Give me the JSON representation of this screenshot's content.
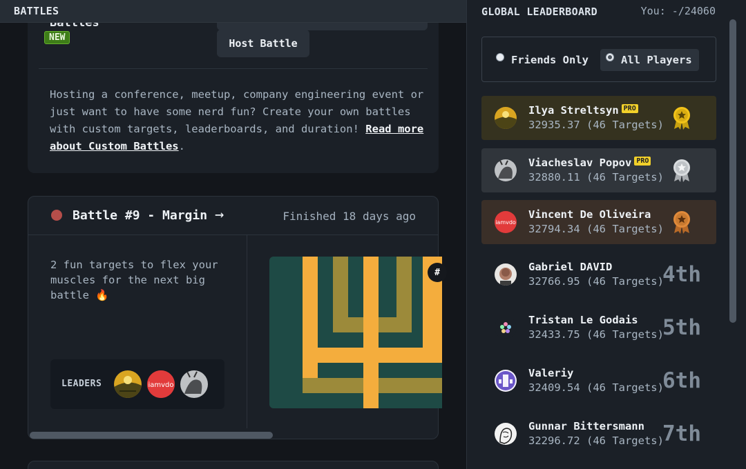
{
  "left": {
    "header_title": "BATTLES",
    "custom_battles": {
      "title": "Battles",
      "badge": "NEW",
      "host_button": "Host Battle",
      "description": "Hosting a conference, meetup, company engineering event or just want to have some nerd fun? Create your own battles with custom targets, leaderboards, and duration!",
      "link_text": "Read more about Custom Battles",
      "link_suffix": "."
    },
    "battle": {
      "title": "Battle #9 - Margin",
      "arrow": "→",
      "status": "Finished 18 days ago",
      "description": "2 fun targets to flex your muscles for the next big battle 🔥",
      "leaders_label": "LEADERS",
      "leader_avatar_text": "iamvdo",
      "target_badge": "#",
      "target_colors": {
        "background": "#1e4a45",
        "primary": "#f4ad3d",
        "secondary": "#9c8a3a"
      }
    }
  },
  "leaderboard": {
    "title": "GLOBAL LEADERBOARD",
    "you": "You: -/24060",
    "filters": [
      {
        "label": "Friends Only",
        "selected": false
      },
      {
        "label": "All Players",
        "selected": true
      }
    ],
    "players": [
      {
        "name": "Ilya Streltsyn",
        "pro": "PRO",
        "score": "32935.37 (46 Targets)",
        "rank": "",
        "medal": "gold",
        "row_color": "#35321f"
      },
      {
        "name": "Viacheslav Popov",
        "pro": "PRO",
        "score": "32880.11 (46 Targets)",
        "rank": "",
        "medal": "silver",
        "row_color": "#30353b"
      },
      {
        "name": "Vincent De Oliveira",
        "pro": "",
        "score": "32794.34 (46 Targets)",
        "rank": "",
        "medal": "bronze",
        "row_color": "#3a2f28",
        "avatar_text": "iamvdo"
      },
      {
        "name": "Gabriel DAVID",
        "pro": "",
        "score": "32766.95 (46 Targets)",
        "rank": "4th"
      },
      {
        "name": "Tristan Le Godais",
        "pro": "",
        "score": "32433.75 (46 Targets)",
        "rank": "5th"
      },
      {
        "name": "Valeriy",
        "pro": "",
        "score": "32409.54 (46 Targets)",
        "rank": "6th"
      },
      {
        "name": "Gunnar Bittersmann",
        "pro": "",
        "score": "32296.72 (46 Targets)",
        "rank": "7th"
      }
    ]
  },
  "colors": {
    "gold": "#f2c319",
    "silver": "#d9dcdf",
    "bronze": "#e08a3a",
    "new_badge": "#3e7d18",
    "live_dot": "#b54e4a"
  }
}
